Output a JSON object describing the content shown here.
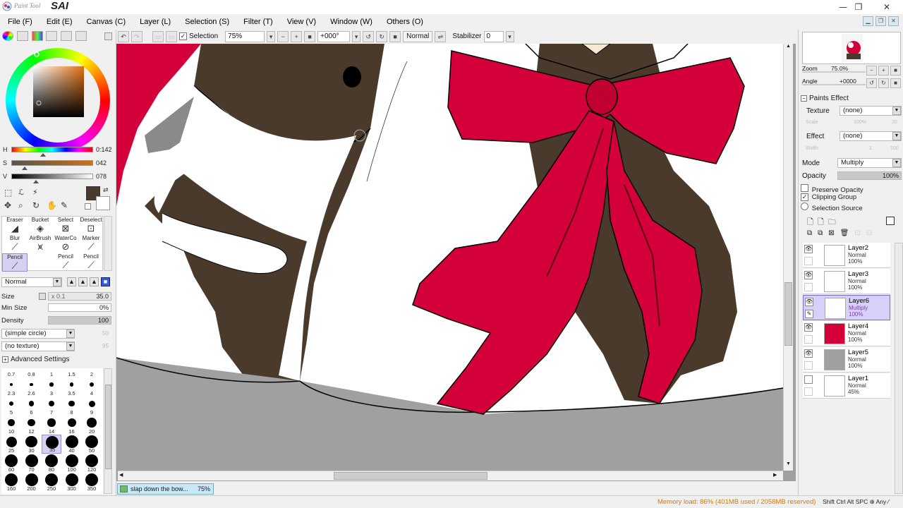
{
  "app": {
    "logo_small": "Paint Tool",
    "logo_big": "SAI"
  },
  "window_controls": {
    "minimize": "—",
    "maximize": "❐",
    "close": "✕"
  },
  "menu": [
    {
      "label": "File (F)"
    },
    {
      "label": "Edit (E)"
    },
    {
      "label": "Canvas (C)"
    },
    {
      "label": "Layer (L)"
    },
    {
      "label": "Selection (S)"
    },
    {
      "label": "Filter (T)"
    },
    {
      "label": "View (V)"
    },
    {
      "label": "Window (W)"
    },
    {
      "label": "Others (O)"
    }
  ],
  "toolbar": {
    "selection_label": "Selection",
    "zoom": "75%",
    "angle": "+000°",
    "blend": "Normal",
    "stabilizer_label": "Stabilizer",
    "stabilizer_value": "0"
  },
  "color": {
    "h_label": "H",
    "h_value": "0:142",
    "s_label": "S",
    "s_value": "042",
    "v_label": "V",
    "v_value": "078",
    "h_fraction": 0.39,
    "s_fraction": 0.16,
    "v_fraction": 0.3,
    "primary": "#4a3a2c",
    "secondary": "#ffffff"
  },
  "tools": {
    "row1": [
      "Eraser",
      "Bucket",
      "Select",
      "Deselect"
    ],
    "row2": [
      "Blur",
      "AirBrush",
      "WaterCo",
      "Marker"
    ],
    "row3": [
      "Pencil",
      "",
      "Pencil",
      "Pencil"
    ]
  },
  "brush": {
    "mode": "Normal",
    "size_label": "Size",
    "size_mult": "x 0.1",
    "size_value": "35.0",
    "minsize_label": "Min Size",
    "minsize_value": "0%",
    "density_label": "Density",
    "density_value": "100",
    "shape": "(simple circle)",
    "shape_val": "50",
    "texture": "(no texture)",
    "texture_val": "95",
    "advanced_label": "Advanced Settings"
  },
  "brush_sizes": [
    "0.7",
    "0.8",
    "1",
    "1.5",
    "2",
    "2.3",
    "2.6",
    "3",
    "3.5",
    "4",
    "5",
    "6",
    "7",
    "8",
    "9",
    "10",
    "12",
    "14",
    "16",
    "20",
    "25",
    "30",
    "35",
    "40",
    "50",
    "60",
    "70",
    "80",
    "100",
    "120",
    "160",
    "200",
    "250",
    "300",
    "350"
  ],
  "nav": {
    "zoom_label": "Zoom",
    "zoom_value": "75.0%",
    "angle_label": "Angle",
    "angle_value": "+0000"
  },
  "paints_effect": {
    "title": "Paints Effect",
    "texture_label": "Texture",
    "texture_value": "(none)",
    "scale_label": "Scale",
    "scale_value": "100%",
    "scale_num": "20",
    "effect_label": "Effect",
    "effect_value": "(none)",
    "width_label": "Width",
    "width_value": "1",
    "width_num": "100"
  },
  "layer_props": {
    "mode_label": "Mode",
    "mode_value": "Multiply",
    "opacity_label": "Opacity",
    "opacity_value": "100%",
    "preserve_opacity": "Preserve Opacity",
    "clipping_group": "Clipping Group",
    "selection_source": "Selection Source"
  },
  "layers": [
    {
      "name": "Layer2",
      "mode": "Normal",
      "opacity": "100%"
    },
    {
      "name": "Layer3",
      "mode": "Normal",
      "opacity": "100%"
    },
    {
      "name": "Layer6",
      "mode": "Multiply",
      "opacity": "100%"
    },
    {
      "name": "Layer4",
      "mode": "Normal",
      "opacity": "100%"
    },
    {
      "name": "Layer5",
      "mode": "Normal",
      "opacity": "100%"
    },
    {
      "name": "Layer1",
      "mode": "Normal",
      "opacity": "45%"
    }
  ],
  "document_tab": {
    "name": "slap down the bow...",
    "zoom": "75%"
  },
  "status": {
    "memory": "Memory load: 86% (401MB used / 2058MB reserved)",
    "keys": "Shift Ctrl Alt SPC ⊕ Any ⁄"
  },
  "colors": {
    "bow_red": "#d4003a",
    "shadow_brown": "#4a3a2c",
    "canvas_gray": "#a0a0a0",
    "accent_purple": "#7a68e0"
  }
}
